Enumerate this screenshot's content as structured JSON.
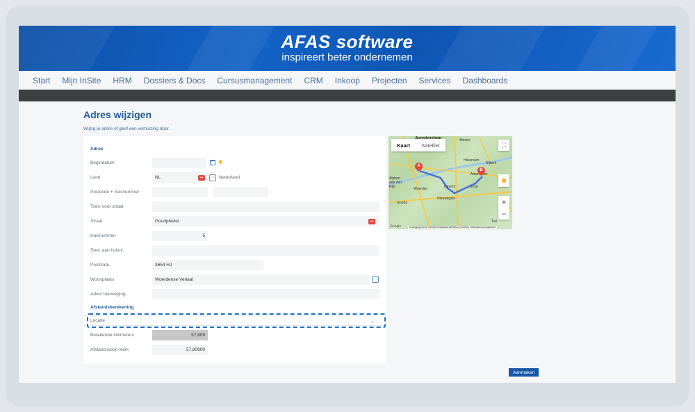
{
  "header": {
    "logo_main": "AFAS software",
    "logo_sub": "inspireert beter ondernemen"
  },
  "nav": [
    "Start",
    "Mijn InSite",
    "HRM",
    "Dossiers & Docs",
    "Cursusmanagement",
    "CRM",
    "Inkoop",
    "Projecten",
    "Services",
    "Dashboards"
  ],
  "page": {
    "title": "Adres wijzigen",
    "subtitle": "Wijzig je adres of geef een verhuizing door."
  },
  "form": {
    "section_address": "Adres",
    "begindatum_label": "Begindatum",
    "begindatum_value": "",
    "land_label": "Land",
    "land_value": "NL",
    "land_name": "Nederland",
    "postcode_huisnummer_label": "Postcode + huisnummer",
    "toev_straat_label": "Toev. voor straat",
    "straat_label": "Straat",
    "straat_value": "Goudplevier",
    "huisnummer_label": "Huisnummer",
    "huisnummer_value": "5",
    "toev_huisnr_label": "Toev. aan huisnr.",
    "postcode_label": "Postcode",
    "postcode_value": "3654 HJ",
    "woonplaats_label": "Woonplaats",
    "woonplaats_value": "Woerdense Verlaat",
    "adres_toevoeging_label": "Adres toevoeging",
    "section_distance": "Afstandsberekening",
    "locatie_placeholder": "Locatie",
    "berekende_km_label": "Berekende kilometers",
    "berekende_km_value": "57,809",
    "afstand_label": "Afstand woon-werk",
    "afstand_value": "57,80900"
  },
  "map": {
    "tab_map": "Kaart",
    "tab_satellite": "Satelliet",
    "marker_a": "A",
    "marker_b": "B",
    "places": [
      "Amsterdam",
      "Almere",
      "Hilversum",
      "Nijkerk",
      "Amersfoort",
      "Woerden",
      "Utrecht",
      "Zeist",
      "Nieuwegein",
      "Gouda",
      "Alphen aan den Rijn",
      "Tiel"
    ],
    "attribution": "Kaartgegevens ©2023 GeoBasis-DE/BKG (©2009)   Gebruiksvoorwaarden",
    "google": "Google",
    "colors": {
      "road": "#f6c94a",
      "route": "#4a6fd6",
      "water": "#9fc6e8",
      "marker": "#e0483c"
    }
  },
  "actions": {
    "submit_label": "Aanmaken"
  },
  "colors": {
    "brand_blue": "#1463c6",
    "nav_text": "#4a6f95",
    "title_blue": "#1f5a94",
    "dark_bar": "#3c4043",
    "highlight": "#1a70c4"
  }
}
